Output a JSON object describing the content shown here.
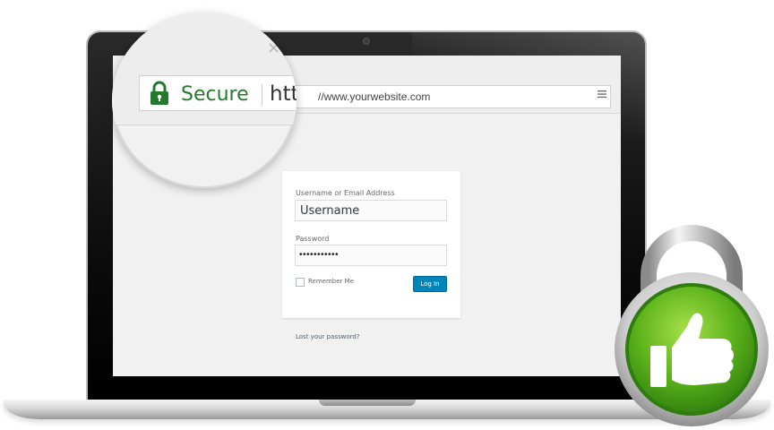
{
  "browser": {
    "url": "//www.yourwebsite.com",
    "menu_icon": "hamburger-menu-icon"
  },
  "magnifier": {
    "secure_label": "Secure",
    "url_start": "htt",
    "close_icon": "close-icon",
    "lock_icon": "lock-icon"
  },
  "login": {
    "username_label": "Username or Email Address",
    "username_value": "Username",
    "password_label": "Password",
    "password_value": "•••••••••••",
    "remember_label": "Remember Me",
    "login_button": "Log In",
    "lost_password": "Lost your password?"
  },
  "badge": {
    "icon": "thumbs-up-padlock-icon",
    "colors": {
      "green": "#5cb21a",
      "green_dark": "#2f7d0f",
      "shackle": "#d0d0d0"
    }
  },
  "colors": {
    "secure_green": "#237a2c",
    "button_blue": "#0085ba"
  }
}
